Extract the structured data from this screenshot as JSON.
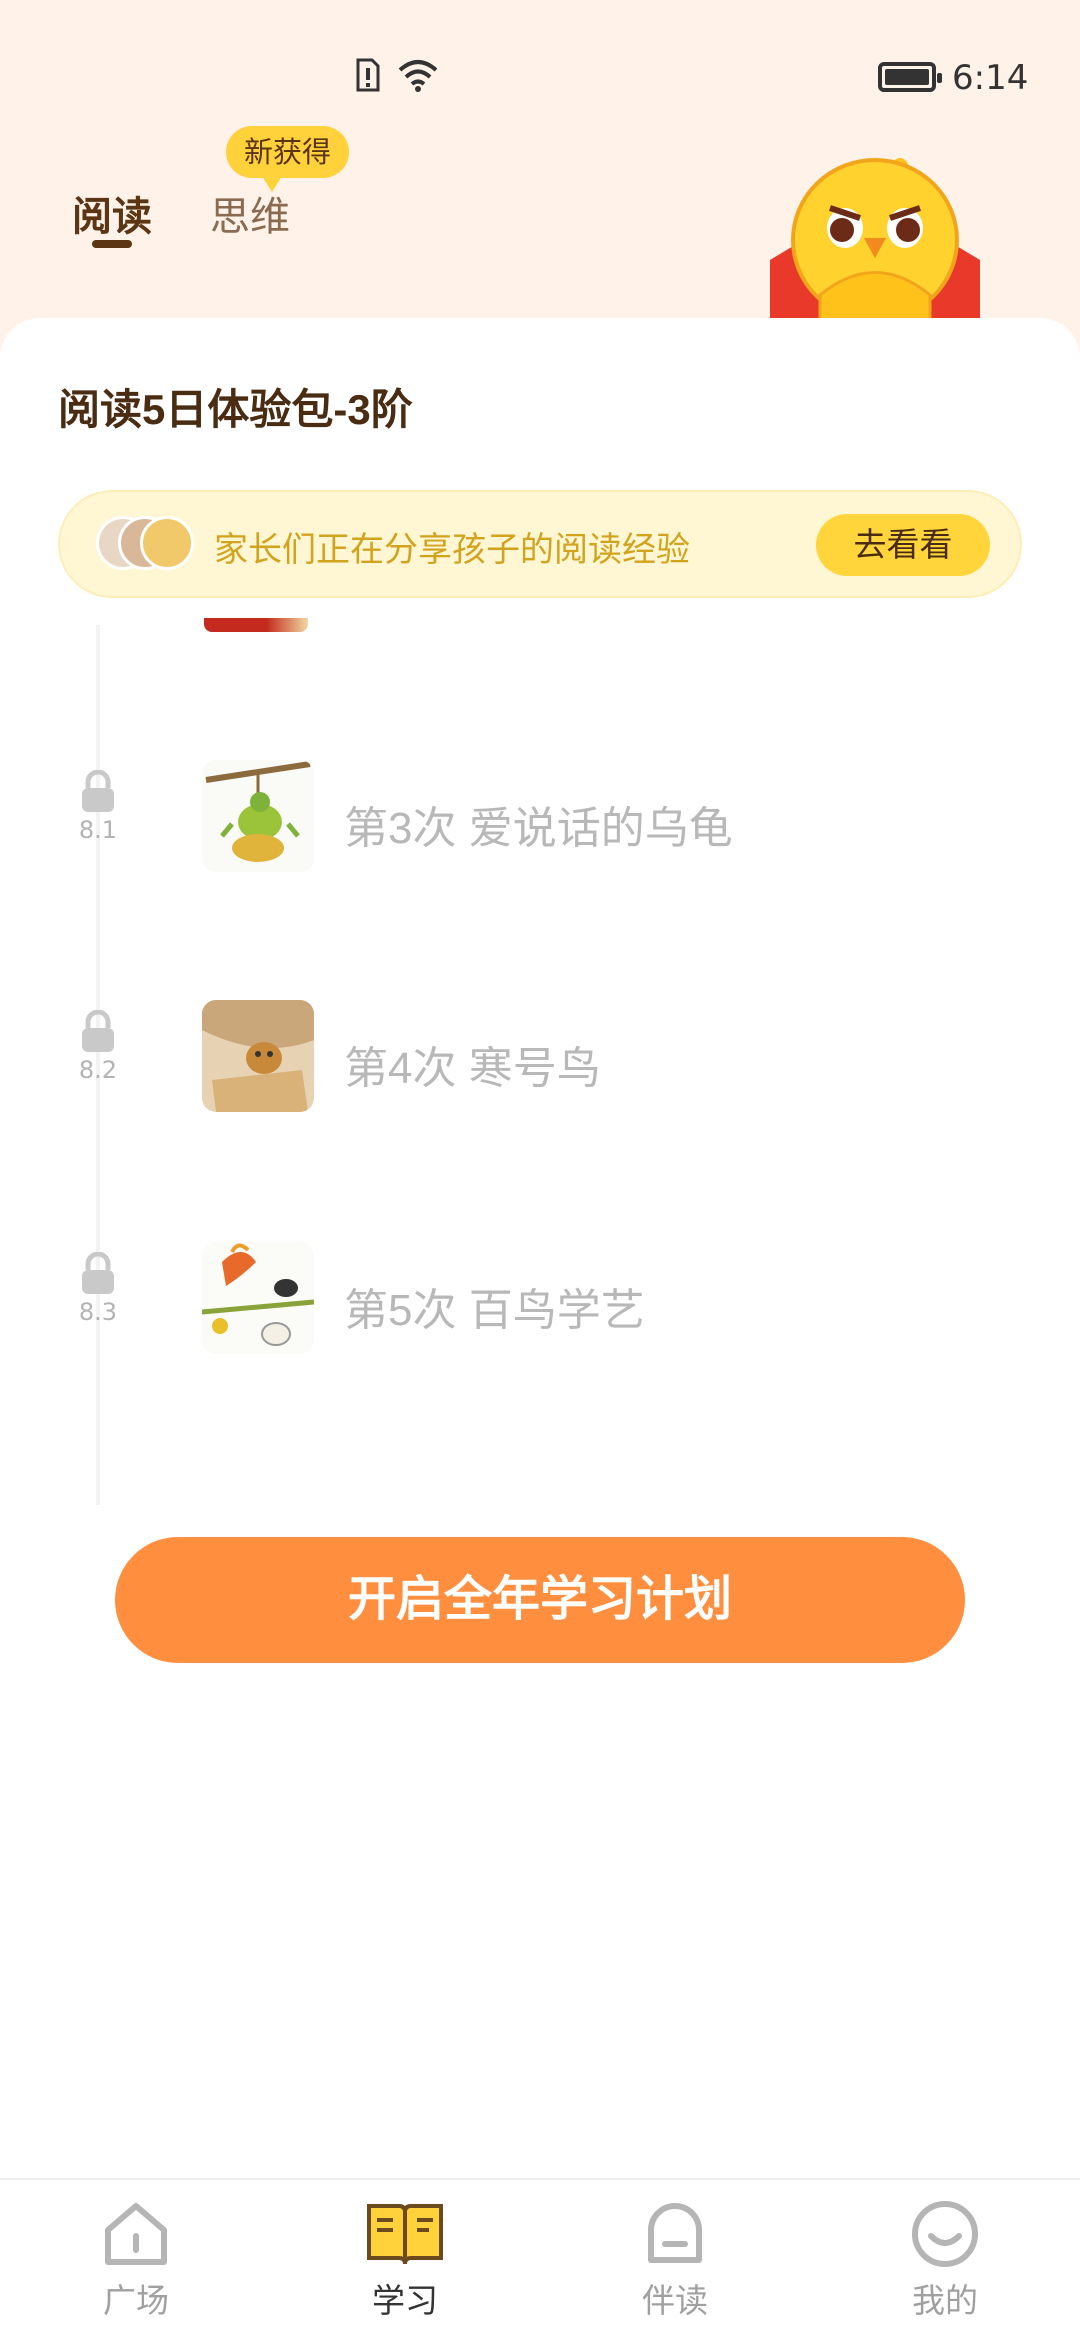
{
  "status_bar": {
    "time": "6:14"
  },
  "tabs": [
    {
      "label": "阅读",
      "active": true
    },
    {
      "label": "思维",
      "active": false,
      "badge": "新获得"
    }
  ],
  "package": {
    "title": "阅读5日体验包-3阶"
  },
  "share_banner": {
    "text": "家长们正在分享孩子的阅读经验",
    "button": "去看看"
  },
  "lessons": [
    {
      "date": "8.1",
      "title": "第3次 爱说话的乌龟",
      "locked": true
    },
    {
      "date": "8.2",
      "title": "第4次 寒号鸟",
      "locked": true
    },
    {
      "date": "8.3",
      "title": "第5次 百鸟学艺",
      "locked": true
    }
  ],
  "cta": {
    "label": "开启全年学习计划",
    "color": "#FF8F3F"
  },
  "bottom_nav": [
    {
      "label": "广场",
      "icon": "home-icon",
      "active": false
    },
    {
      "label": "学习",
      "icon": "book-icon",
      "active": true
    },
    {
      "label": "伴读",
      "icon": "bell-icon",
      "active": false
    },
    {
      "label": "我的",
      "icon": "smile-icon",
      "active": false
    }
  ],
  "colors": {
    "accent": "#FFD13A",
    "brown": "#5B3514",
    "page_bg": "#FFF2E9"
  }
}
